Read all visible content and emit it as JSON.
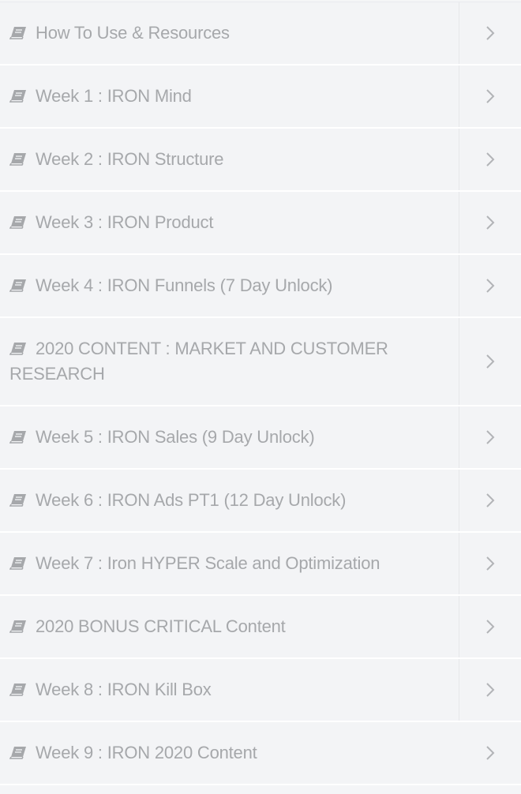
{
  "lessons": [
    {
      "label": "How To Use & Resources"
    },
    {
      "label": "Week 1 : IRON Mind"
    },
    {
      "label": "Week 2 : IRON Structure"
    },
    {
      "label": "Week 3 : IRON Product"
    },
    {
      "label": "Week 4 : IRON Funnels (7 Day Unlock)"
    },
    {
      "label": "2020 CONTENT : MARKET AND CUSTOMER RESEARCH"
    },
    {
      "label": "Week 5 : IRON Sales (9 Day Unlock)"
    },
    {
      "label": "Week 6 : IRON Ads PT1 (12 Day Unlock)"
    },
    {
      "label": "Week 7 : Iron HYPER Scale and Optimization"
    },
    {
      "label": "2020 BONUS CRITICAL Content"
    },
    {
      "label": "Week 8 : IRON Kill Box"
    },
    {
      "label": "Week 9 : IRON 2020 Content"
    }
  ],
  "icons": {
    "item_icon": "book-icon",
    "expand_icon": "chevron-right-icon"
  },
  "colors": {
    "text": "#a6a8ab",
    "background": "#f3f4f6",
    "divider": "#ffffff"
  }
}
